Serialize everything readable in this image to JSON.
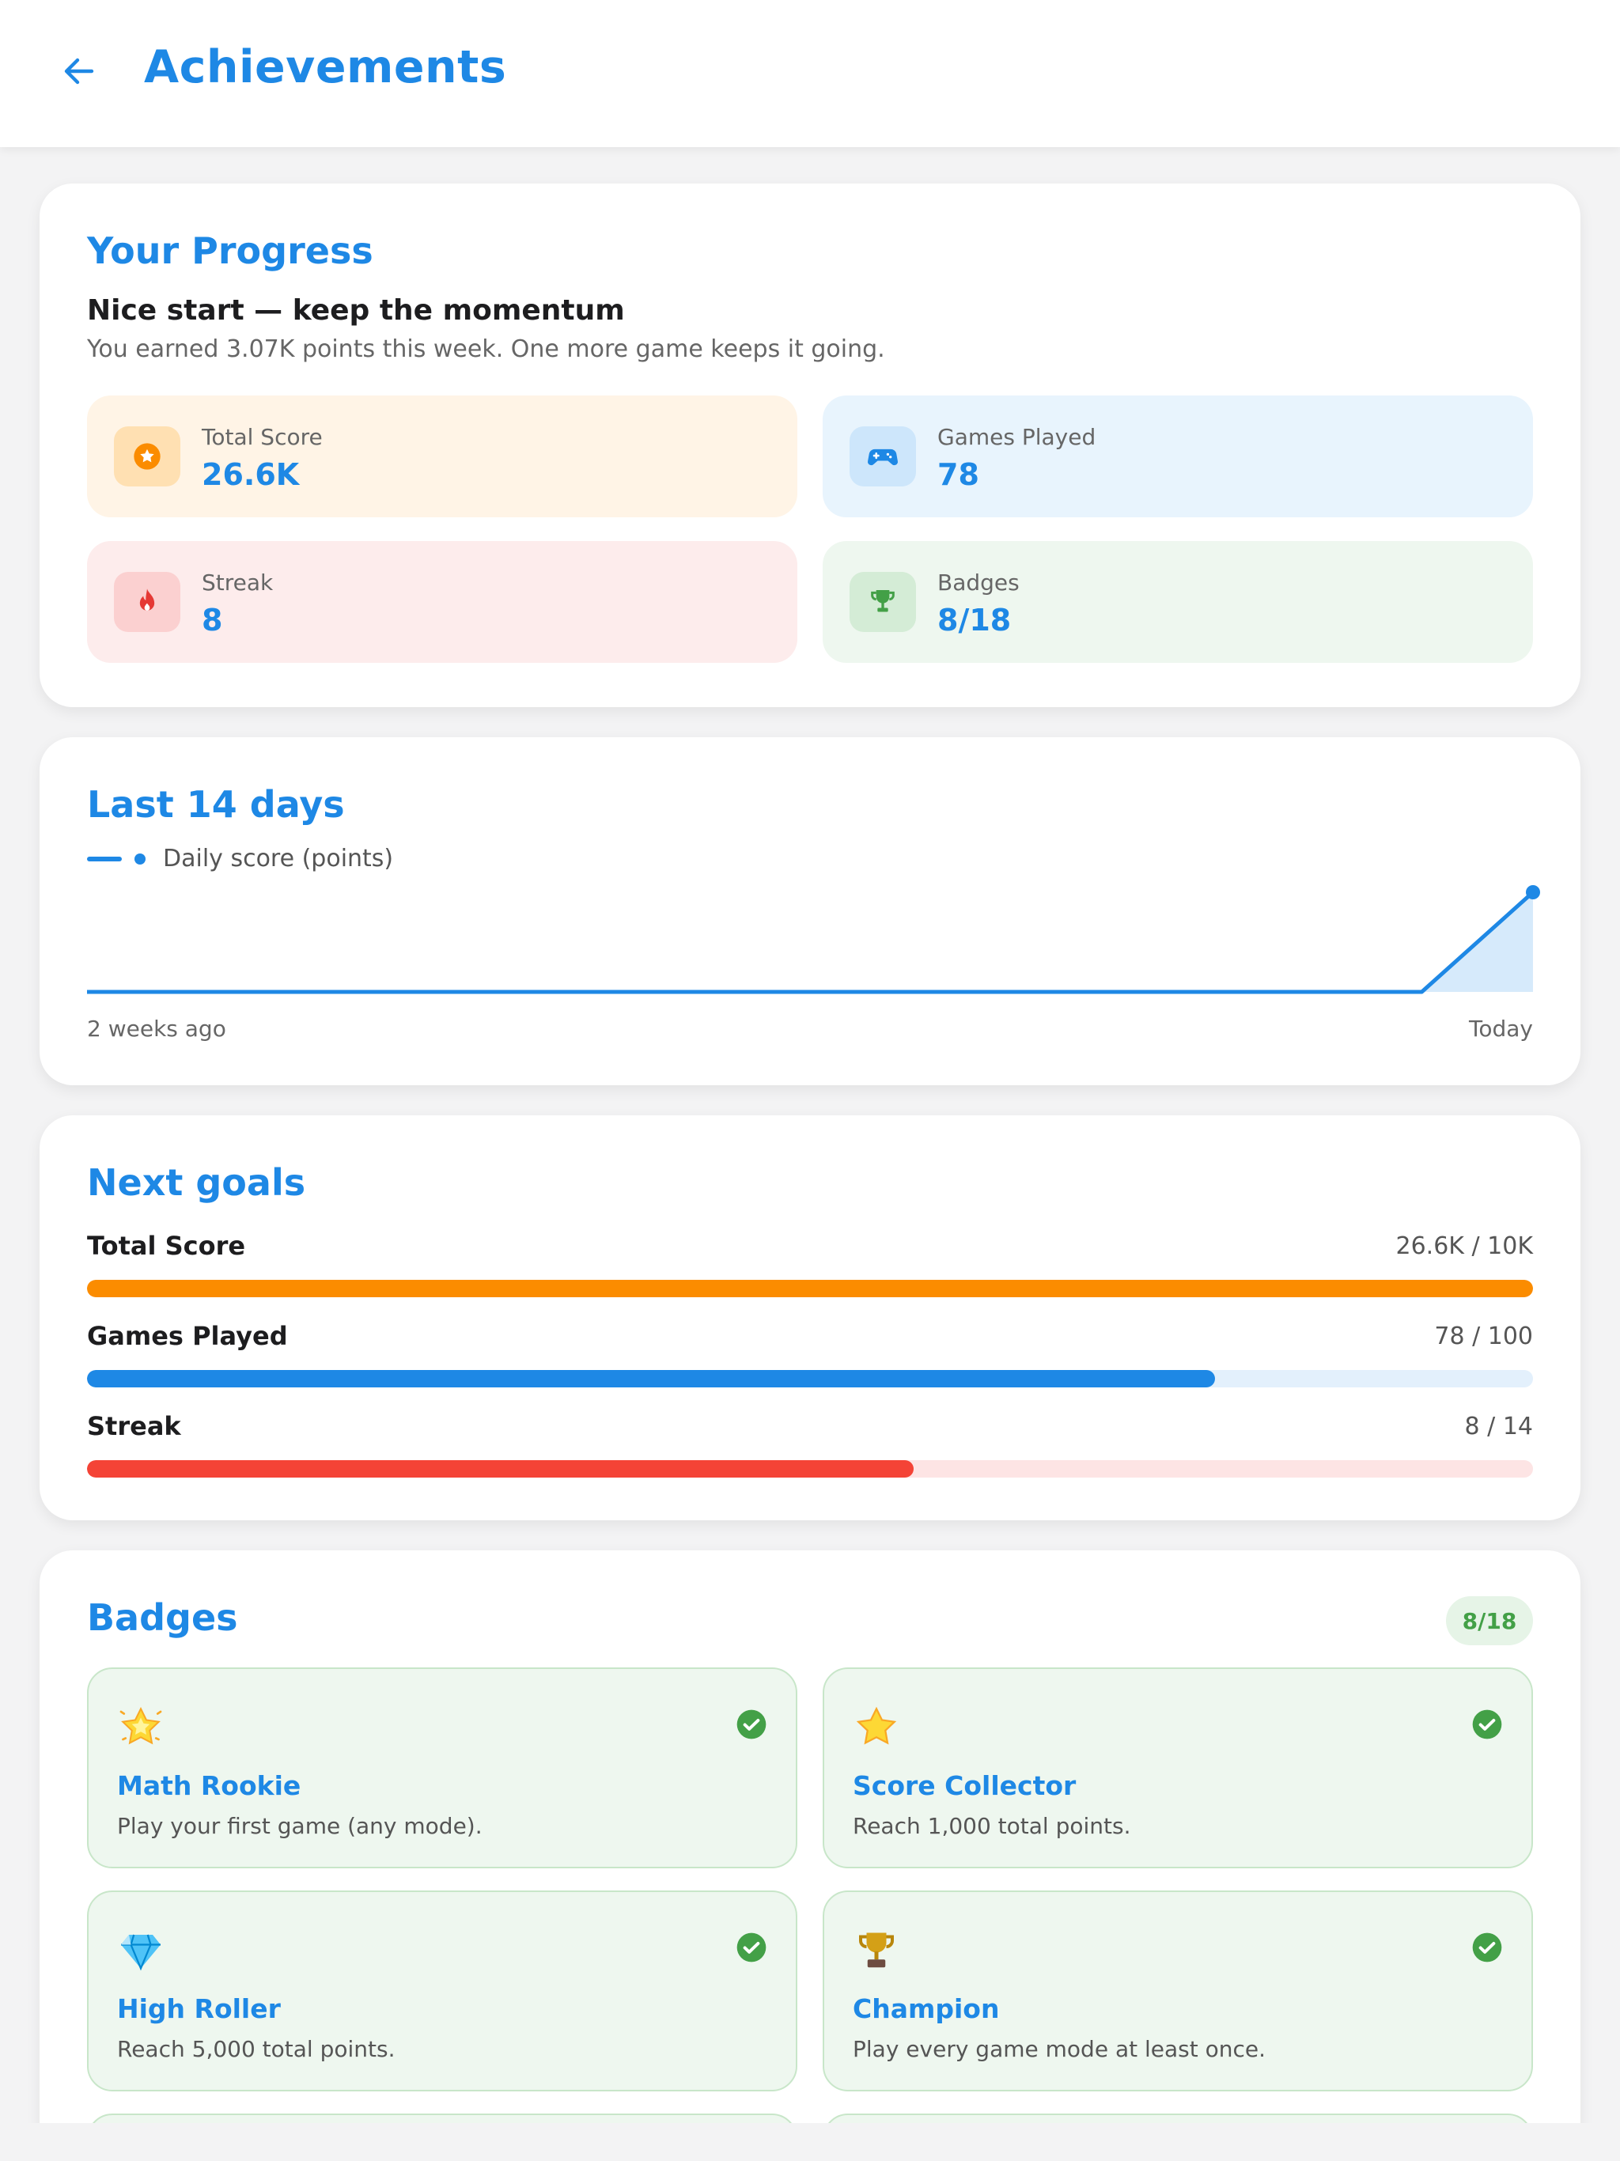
{
  "header": {
    "title": "Achievements"
  },
  "progress": {
    "title": "Your Progress",
    "headline": "Nice start — keep the momentum",
    "subtitle": "You earned 3.07K points this week. One more game keeps it going.",
    "stats": [
      {
        "label": "Total Score",
        "value": "26.6K",
        "icon": "star-coin-icon",
        "bg": "#fff4e6",
        "icon_bg": "#ffe0b2",
        "icon_color": "#fb8c00"
      },
      {
        "label": "Games Played",
        "value": "78",
        "icon": "gamepad-icon",
        "bg": "#e8f4fd",
        "icon_bg": "#cde6fb",
        "icon_color": "#1e88e5"
      },
      {
        "label": "Streak",
        "value": "8",
        "icon": "flame-icon",
        "bg": "#fdecec",
        "icon_bg": "#fbd0d0",
        "icon_color": "#e53935"
      },
      {
        "label": "Badges",
        "value": "8/18",
        "icon": "trophy-icon",
        "bg": "#eef7ef",
        "icon_bg": "#d4ecd6",
        "icon_color": "#43a047"
      }
    ]
  },
  "chart_data": {
    "type": "area",
    "title": "Last 14 days",
    "legend": "Daily score (points)",
    "series": [
      {
        "name": "Daily score (points)",
        "values": [
          0,
          0,
          0,
          0,
          0,
          0,
          0,
          0,
          0,
          0,
          0,
          0,
          0,
          3070
        ]
      }
    ],
    "x_start_label": "2 weeks ago",
    "x_end_label": "Today",
    "color": "#1e88e5",
    "fill": "#d6eafb"
  },
  "goals": {
    "title": "Next goals",
    "items": [
      {
        "label": "Total Score",
        "value": "26.6K / 10K",
        "fraction": 1.0,
        "color": "#fb8c00",
        "track": "#fde3bf"
      },
      {
        "label": "Games Played",
        "value": "78 / 100",
        "fraction": 0.78,
        "color": "#1e88e5",
        "track": "#e3f0fc"
      },
      {
        "label": "Streak",
        "value": "8 / 14",
        "fraction": 0.5714,
        "color": "#f44336",
        "track": "#fde4e4"
      }
    ]
  },
  "badges": {
    "title": "Badges",
    "count": "8/18",
    "items": [
      {
        "name": "Math Rookie",
        "description": "Play your first game (any mode).",
        "icon": "glowing-star-icon",
        "earned": true
      },
      {
        "name": "Score Collector",
        "description": "Reach 1,000 total points.",
        "icon": "star-icon",
        "earned": true
      },
      {
        "name": "High Roller",
        "description": "Reach 5,000 total points.",
        "icon": "gem-icon",
        "earned": true
      },
      {
        "name": "Champion",
        "description": "Play every game mode at least once.",
        "icon": "trophy-icon",
        "earned": true
      }
    ]
  }
}
